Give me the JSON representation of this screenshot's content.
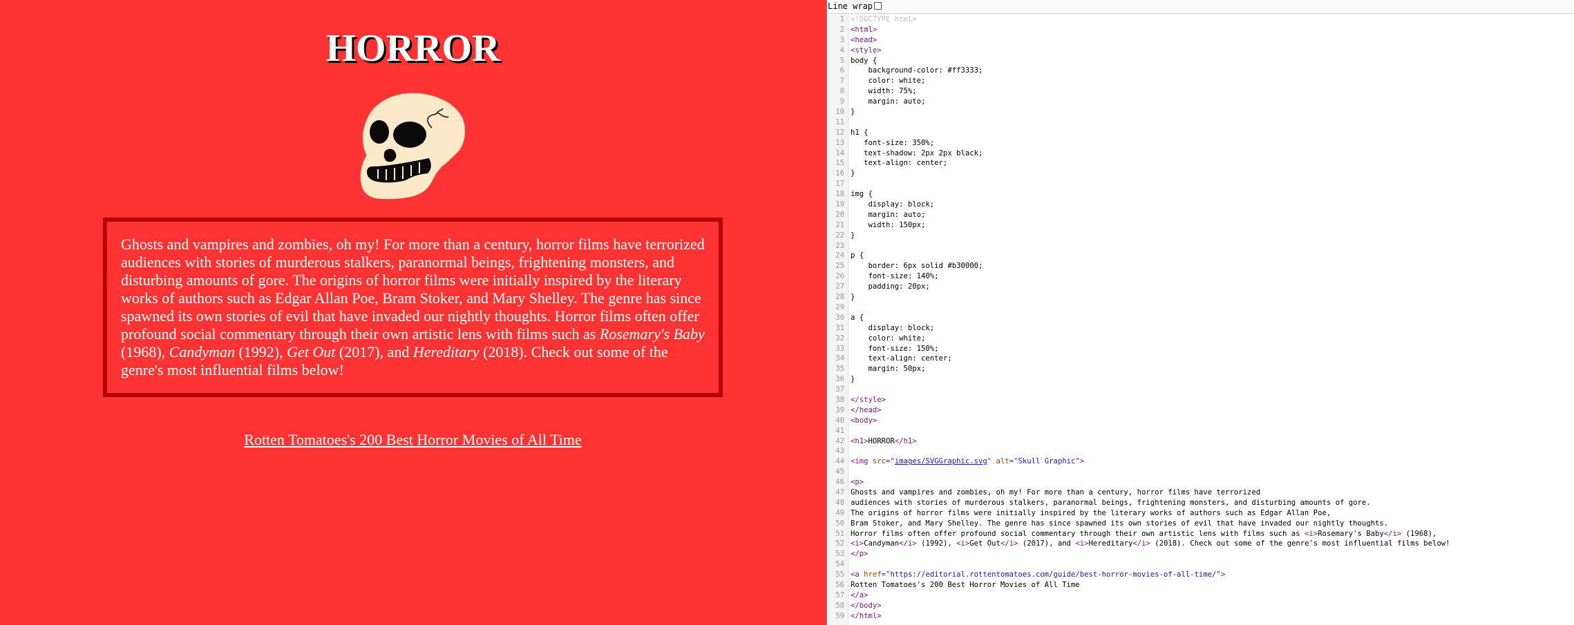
{
  "preview": {
    "heading": "HORROR",
    "image_alt": "Skull Graphic",
    "paragraph": {
      "intro": "Ghosts and vampires and zombies, oh my! For more than a century, horror films have terrorized audiences with stories of murderous stalkers, paranormal beings, frightening monsters, and disturbing amounts of gore. The origins of horror films were initially inspired by the literary works of authors such as Edgar Allan Poe, Bram Stoker, and Mary Shelley. The genre has since spawned its own stories of evil that have invaded our nightly thoughts. Horror films often offer profound social commentary through their own artistic lens with films such as ",
      "film1": "Rosemary's Baby",
      "sep1": " (1968), ",
      "film2": "Candyman",
      "sep2": " (1992), ",
      "film3": "Get Out",
      "sep3": " (2017), and ",
      "film4": "Hereditary",
      "outro": " (2018). Check out some of the genre's most influential films below!"
    },
    "link_text": "Rotten Tomatoes's 200 Best Horror Movies of All Time"
  },
  "toolbar": {
    "line_wrap_label": "Line wrap",
    "line_wrap_checked": false
  },
  "colors": {
    "page_bg": "#ff3333",
    "border": "#b30000",
    "skull_fill": "#fbe9c9",
    "tag": "#881280",
    "string": "#1a1aa6"
  },
  "code": {
    "lines": [
      "<!DOCTYPE html>",
      "<html>",
      "<head>",
      "<style>",
      "body {",
      "    background-color: #ff3333;",
      "    color: white;",
      "    width: 75%;",
      "    margin: auto;",
      "}",
      "",
      "h1 {",
      "   font-size: 350%;",
      "   text-shadow: 2px 2px black;",
      "   text-align: center;",
      "}",
      "",
      "img {",
      "    display: block;",
      "    margin: auto;",
      "    width: 150px;",
      "}",
      "",
      "p {",
      "    border: 6px solid #b30000;",
      "    font-size: 140%;",
      "    padding: 20px;",
      "}",
      "",
      "a {",
      "    display: block;",
      "    color: white;",
      "    font-size: 150%;",
      "    text-align: center;",
      "    margin: 50px;",
      "}",
      "",
      "</style>",
      "</head>",
      "<body>",
      "",
      "<h1>HORROR</h1>",
      "",
      "<img src=\"images/SVGGraphic.svg\" alt=\"Skull Graphic\">",
      "",
      "<p>",
      "Ghosts and vampires and zombies, oh my! For more than a century, horror films have terrorized",
      "audiences with stories of murderous stalkers, paranormal beings, frightening monsters, and disturbing amounts of gore.",
      "The origins of horror films were initially inspired by the literary works of authors such as Edgar Allan Poe,",
      "Bram Stoker, and Mary Shelley. The genre has since spawned its own stories of evil that have invaded our nightly thoughts.",
      "Horror films often offer profound social commentary through their own artistic lens with films such as <i>Rosemary's Baby</i> (1968),",
      "<i>Candyman</i> (1992), <i>Get Out</i> (2017), and <i>Hereditary</i> (2018). Check out some of the genre's most influential films below!",
      "</p>",
      "",
      "<a href=\"https://editorial.rottentomatoes.com/guide/best-horror-movies-of-all-time/\">",
      "Rotten Tomatoes's 200 Best Horror Movies of All Time",
      "</a>",
      "</body>",
      "</html>"
    ]
  }
}
